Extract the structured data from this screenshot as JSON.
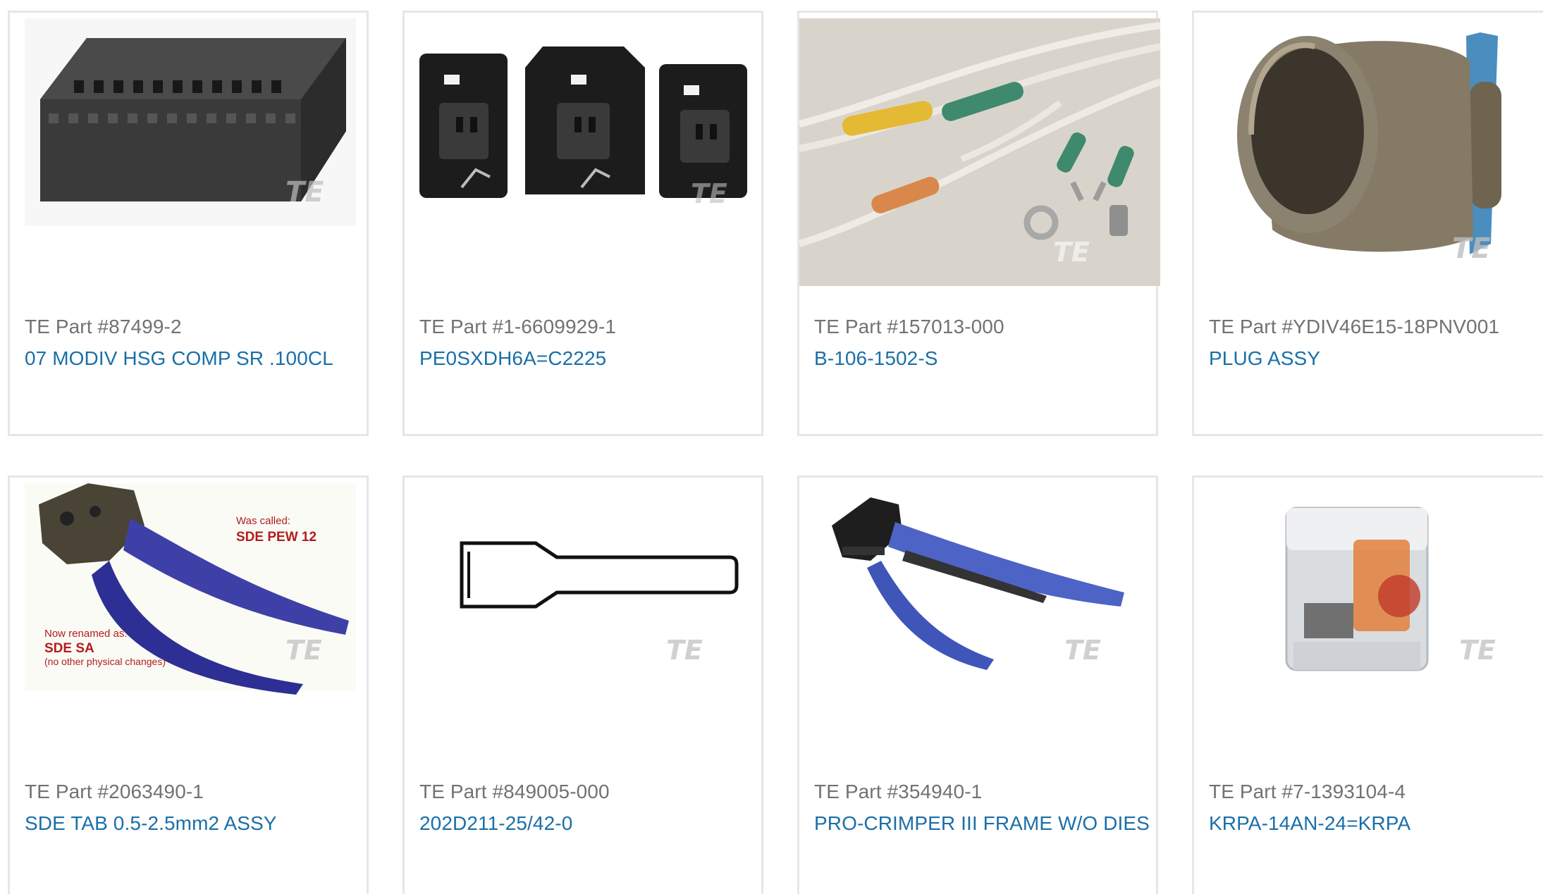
{
  "brand": {
    "watermark": "TE",
    "link_color": "#1a6fa8",
    "label_color": "#727272"
  },
  "products": [
    {
      "part_label": "TE Part #87499-2",
      "name": "07 MODIV HSG COMP SR .100CL",
      "icon": "connector-housing-image"
    },
    {
      "part_label": "TE Part #1-6609929-1",
      "name": "PE0SXDH6A=C2225",
      "icon": "power-entry-module-image"
    },
    {
      "part_label": "TE Part #157013-000",
      "name": "B-106-1502-S",
      "icon": "wire-splice-image"
    },
    {
      "part_label": "TE Part #YDIV46E15-18PNV001",
      "name": "PLUG ASSY",
      "icon": "circular-plug-image"
    },
    {
      "part_label": "TE Part #2063490-1",
      "name": "SDE TAB 0.5-2.5mm2 ASSY",
      "icon": "crimp-tool-image",
      "image_text": {
        "line1": "Was called:",
        "line2": "SDE PEW 12",
        "line3": "Now renamed as:",
        "line4": "SDE SA",
        "line5": "(no other physical changes)"
      }
    },
    {
      "part_label": "TE Part #849005-000",
      "name": "202D211-25/42-0",
      "icon": "sleeve-drawing-image"
    },
    {
      "part_label": "TE Part #354940-1",
      "name": "PRO-CRIMPER III FRAME W/O DIES",
      "icon": "pro-crimper-image"
    },
    {
      "part_label": "TE Part #7-1393104-4",
      "name": "KRPA-14AN-24=KRPA",
      "icon": "relay-image"
    }
  ]
}
